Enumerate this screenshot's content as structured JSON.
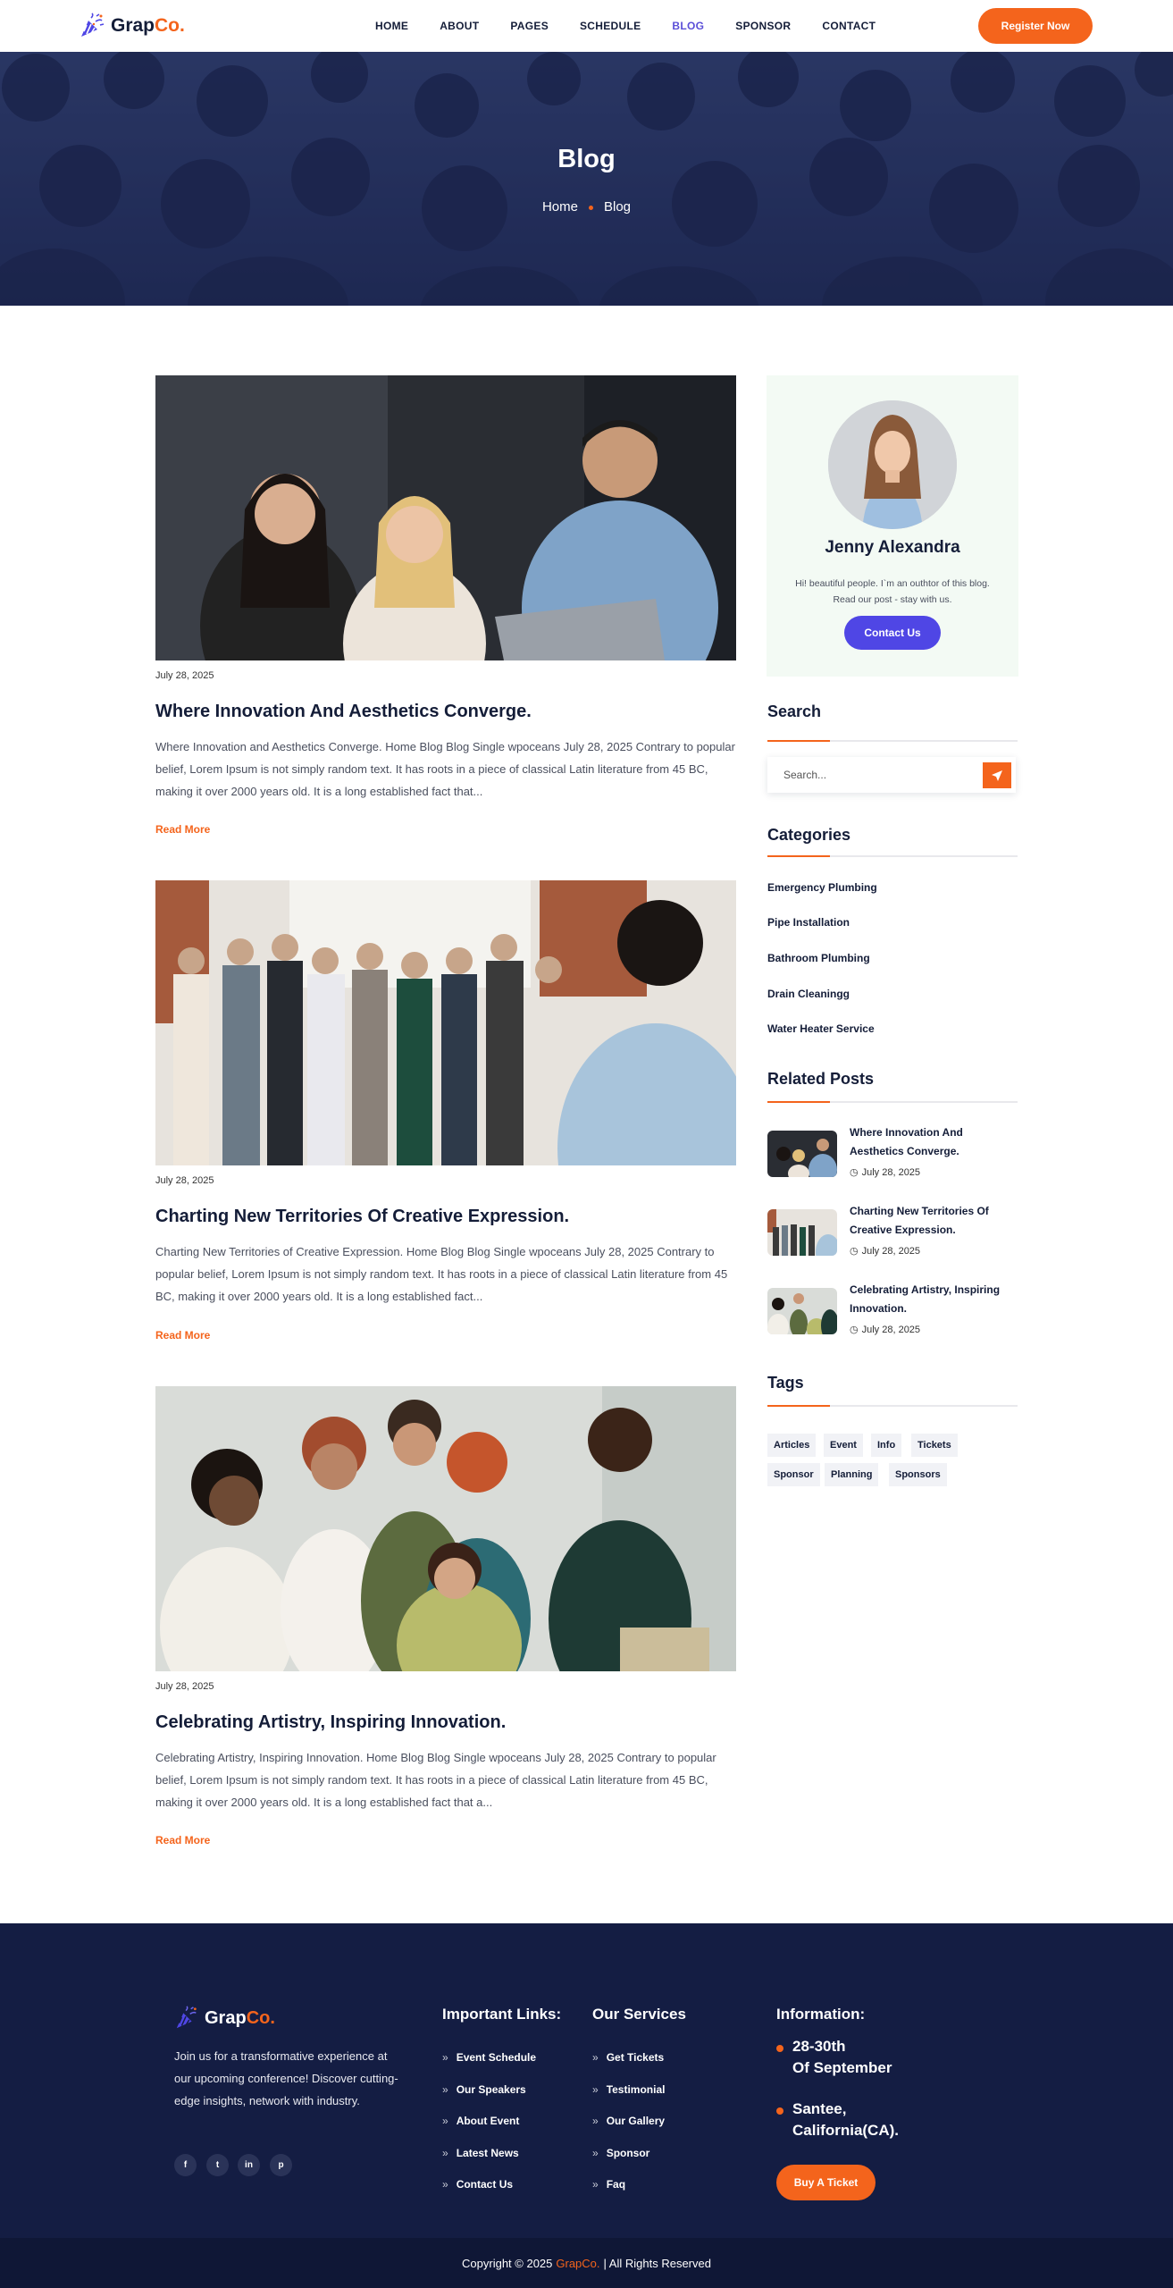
{
  "brand": {
    "name_part1": "Grap",
    "name_part2": "Co.",
    "accent": "#f4641c",
    "icon": "party-popper-icon"
  },
  "nav": {
    "items": [
      {
        "label": "HOME",
        "active": false
      },
      {
        "label": "ABOUT",
        "active": false
      },
      {
        "label": "PAGES",
        "active": false
      },
      {
        "label": "SCHEDULE",
        "active": false
      },
      {
        "label": "BLOG",
        "active": true
      },
      {
        "label": "SPONSOR",
        "active": false
      },
      {
        "label": "CONTACT",
        "active": false
      }
    ],
    "cta": "Register Now"
  },
  "hero": {
    "title": "Blog",
    "breadcrumb": [
      "Home",
      "Blog"
    ]
  },
  "posts": [
    {
      "date": "July 28, 2025",
      "title": "Where Innovation And Aesthetics Converge.",
      "excerpt": "Where Innovation and Aesthetics Converge. Home Blog Blog Single wpoceans July 28, 2025 Contrary to popular belief, Lorem Ipsum is not simply random text. It has roots in a piece of classical Latin literature from 45 BC, making it over 2000 years old. It is a long established fact that...",
      "read_more": "Read More"
    },
    {
      "date": "July 28, 2025",
      "title": "Charting New Territories Of Creative Expression.",
      "excerpt": "Charting New Territories of Creative Expression. Home Blog Blog Single wpoceans July 28, 2025 Contrary to popular belief, Lorem Ipsum is not simply random text. It has roots in a piece of classical Latin literature from 45 BC, making it over 2000 years old. It is a long established fact...",
      "read_more": "Read More"
    },
    {
      "date": "July 28, 2025",
      "title": "Celebrating Artistry, Inspiring Innovation.",
      "excerpt": "Celebrating Artistry, Inspiring Innovation. Home Blog Blog Single wpoceans July 28, 2025 Contrary to popular belief, Lorem Ipsum is not simply random text. It has roots in a piece of classical Latin literature from 45 BC, making it over 2000 years old. It is a long established fact that a...",
      "read_more": "Read More"
    }
  ],
  "author": {
    "name": "Jenny Alexandra",
    "bio": "Hi! beautiful people. I`m an outhtor of this blog. Read our post - stay with us.",
    "button": "Contact Us"
  },
  "search": {
    "heading": "Search",
    "placeholder": "Search..."
  },
  "categories": {
    "heading": "Categories",
    "items": [
      "Emergency Plumbing",
      "Pipe Installation",
      "Bathroom Plumbing",
      "Drain Cleaningg",
      "Water Heater Service"
    ]
  },
  "related": {
    "heading": "Related Posts",
    "items": [
      {
        "title": "Where Innovation And Aesthetics Converge.",
        "date": "July 28, 2025"
      },
      {
        "title": "Charting New Territories Of Creative Expression.",
        "date": "July 28, 2025"
      },
      {
        "title": "Celebrating Artistry, Inspiring Innovation.",
        "date": "July 28, 2025"
      }
    ]
  },
  "tags": {
    "heading": "Tags",
    "items": [
      "Articles",
      "Event",
      "Info",
      "Tickets",
      "Sponsor",
      "Planning",
      "Sponsors"
    ]
  },
  "footer": {
    "about": "Join us for a transformative experience at our upcoming conference! Discover cutting-edge insights, network with industry.",
    "social": [
      "f",
      "t",
      "in",
      "p"
    ],
    "links_heading": "Important Links:",
    "links": [
      "Event Schedule",
      "Our Speakers",
      "About Event",
      "Latest News",
      "Contact Us"
    ],
    "services_heading": "Our Services",
    "services": [
      "Get Tickets",
      "Testimonial",
      "Our Gallery",
      "Sponsor",
      "Faq"
    ],
    "info_heading": "Information:",
    "info_date_line1": "28-30th",
    "info_date_line2": "Of September",
    "info_place_line1": "Santee,",
    "info_place_line2": "California(CA).",
    "buy": "Buy A Ticket",
    "copy_pre": "Copyright © 2025",
    "copy_brand": "GrapCo.",
    "copy_post": "| All Rights Reserved"
  }
}
